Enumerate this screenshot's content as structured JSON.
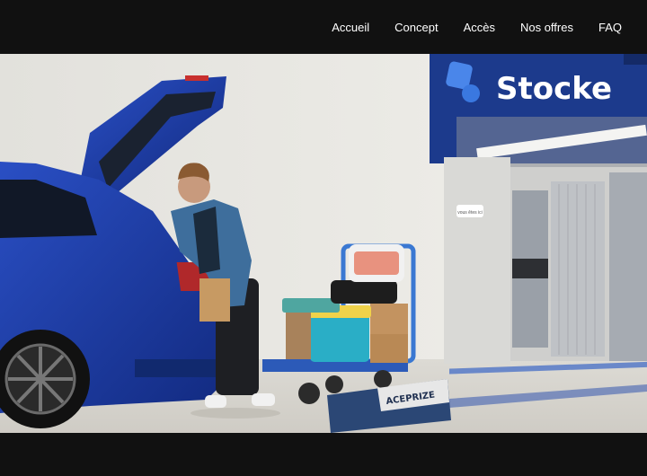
{
  "nav": {
    "items": [
      {
        "label": "Accueil"
      },
      {
        "label": "Concept"
      },
      {
        "label": "Accès"
      },
      {
        "label": "Nos offres"
      },
      {
        "label": "FAQ"
      }
    ]
  },
  "hero": {
    "sign_text": "Stocke",
    "door_sign": "vous êtes ici",
    "box_brand": "ACEPRIZE"
  },
  "colors": {
    "brand_blue": "#1c3a8c",
    "car_blue": "#1a39a5",
    "nav_bg": "#111111"
  }
}
